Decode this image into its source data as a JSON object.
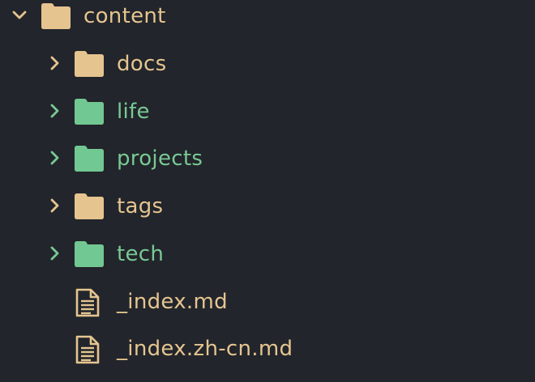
{
  "colors": {
    "background": "#22252b",
    "default_label": "#e5c590",
    "git_label": "#79c994",
    "default_folder": "#e6c48f",
    "git_folder": "#72c892",
    "chevron_default": "#e5c590",
    "chevron_git": "#79c994",
    "file_icon": "#e5c590"
  },
  "tree": {
    "root": {
      "label": "content",
      "expanded": true,
      "icon": "folder-open-icon"
    },
    "children": [
      {
        "label": "docs",
        "type": "folder",
        "status": "default",
        "icon": "folder-icon"
      },
      {
        "label": "life",
        "type": "folder",
        "status": "git",
        "icon": "folder-icon"
      },
      {
        "label": "projects",
        "type": "folder",
        "status": "git",
        "icon": "folder-icon"
      },
      {
        "label": "tags",
        "type": "folder",
        "status": "default",
        "icon": "folder-icon"
      },
      {
        "label": "tech",
        "type": "folder",
        "status": "git",
        "icon": "folder-icon"
      },
      {
        "label": "_index.md",
        "type": "file",
        "status": "default",
        "icon": "document-icon"
      },
      {
        "label": "_index.zh-cn.md",
        "type": "file",
        "status": "default",
        "icon": "document-icon"
      }
    ]
  }
}
